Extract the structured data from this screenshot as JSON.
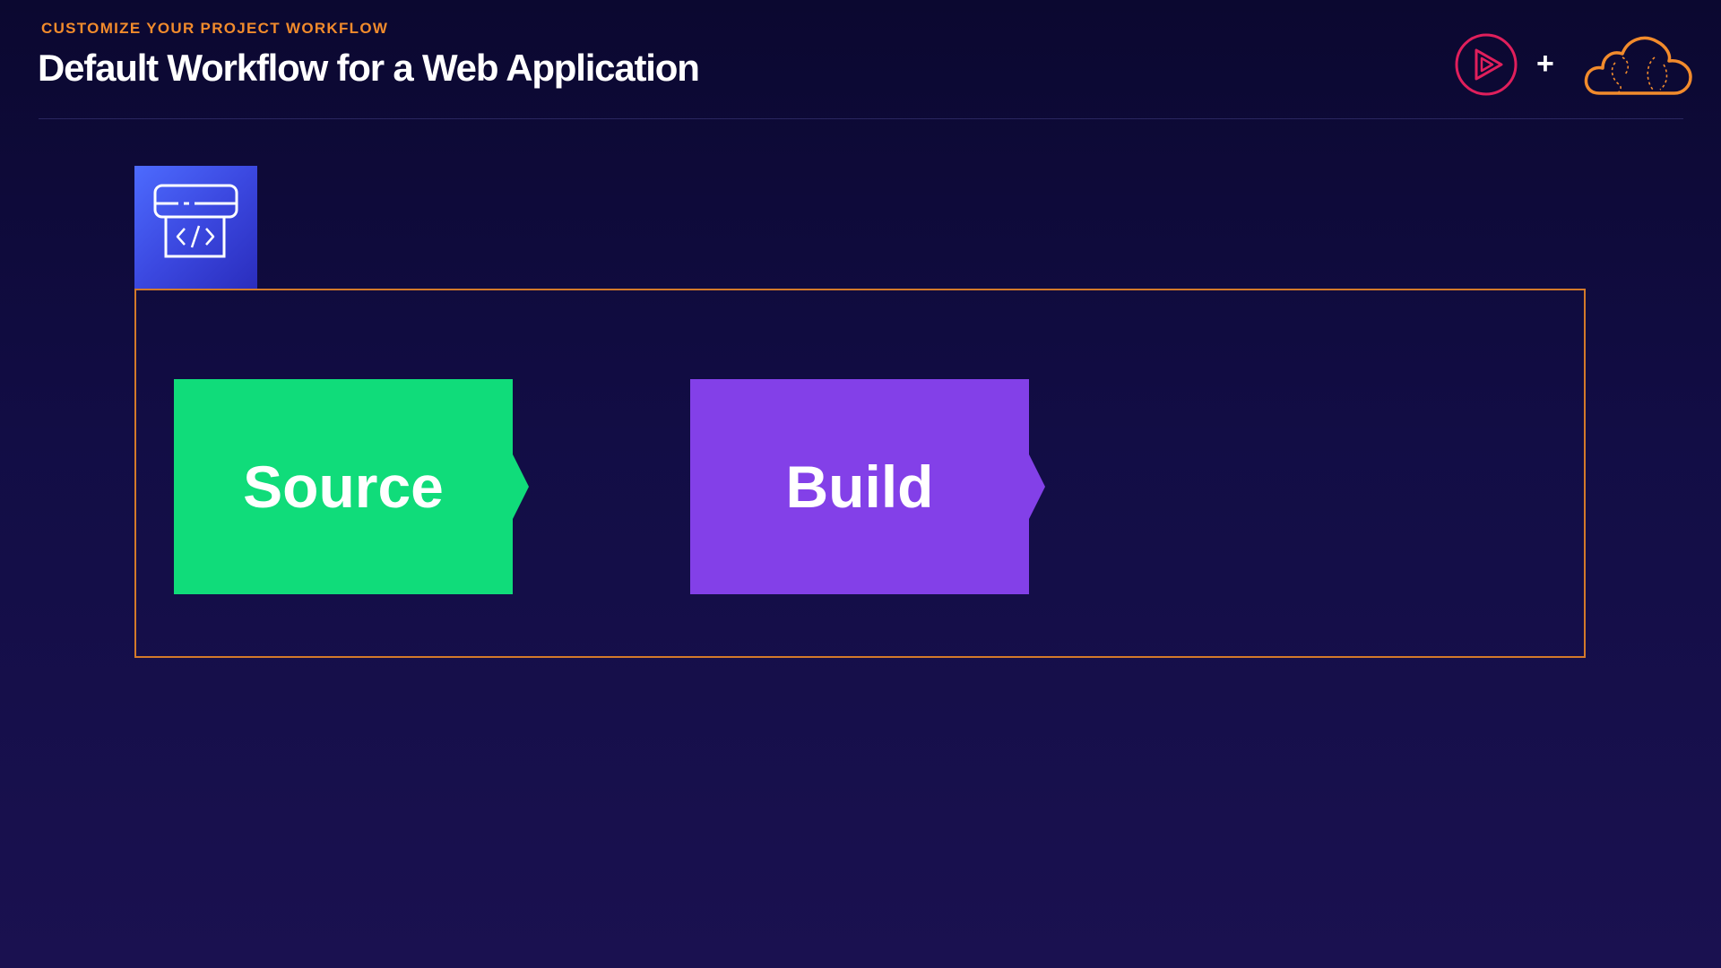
{
  "header": {
    "eyebrow": "CUSTOMIZE YOUR PROJECT WORKFLOW",
    "title": "Default Workflow for a Web Application",
    "plus": "+"
  },
  "icons": {
    "pluralsight": "play-logo-icon",
    "cloud": "cloud-logo-icon",
    "service": "codepipeline-icon"
  },
  "pipeline": {
    "stages": [
      {
        "label": "Source",
        "color": "#10dc7a"
      },
      {
        "label": "Build",
        "color": "#8340e8"
      }
    ]
  },
  "colors": {
    "accent_orange": "#f28b2c",
    "frame_border": "#d37a2a",
    "play_logo": "#e01f5c",
    "background_top": "#0b0830",
    "background_bottom": "#1a1150"
  }
}
